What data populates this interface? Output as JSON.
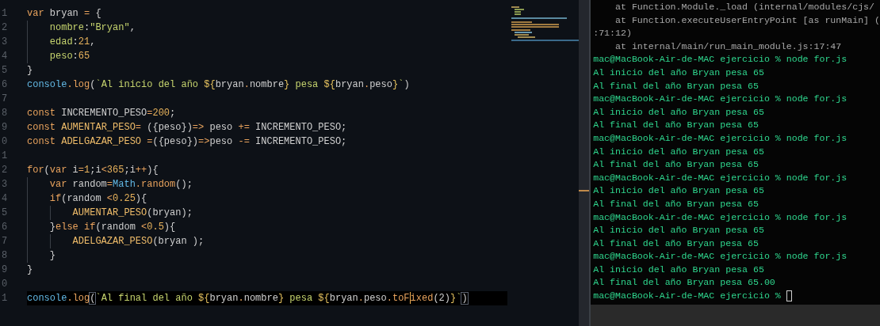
{
  "editor": {
    "lines": [
      {
        "number": "1",
        "current": false,
        "tokens": [
          {
            "t": "var",
            "kind": "kw"
          },
          {
            "t": " bryan ",
            "kind": "id"
          },
          {
            "t": "=",
            "kind": "op"
          },
          {
            "t": " {",
            "kind": "punc"
          }
        ],
        "children": [
          {
            "number": "2",
            "current": false,
            "tokens": [
              {
                "t": "nombre",
                "kind": "prop"
              },
              {
                "t": ":",
                "kind": "punc"
              },
              {
                "t": "\"Bryan\"",
                "kind": "str"
              },
              {
                "t": ",",
                "kind": "punc"
              }
            ]
          },
          {
            "number": "3",
            "current": false,
            "tokens": [
              {
                "t": "edad",
                "kind": "prop"
              },
              {
                "t": ":",
                "kind": "punc"
              },
              {
                "t": "21",
                "kind": "num"
              },
              {
                "t": ",",
                "kind": "punc"
              }
            ]
          },
          {
            "number": "4",
            "current": false,
            "tokens": [
              {
                "t": "peso",
                "kind": "prop"
              },
              {
                "t": ":",
                "kind": "punc"
              },
              {
                "t": "65",
                "kind": "num"
              }
            ]
          }
        ]
      },
      {
        "number": "5",
        "current": false,
        "tokens": [
          {
            "t": "}",
            "kind": "punc"
          }
        ]
      },
      {
        "number": "6",
        "current": false,
        "tokens": [
          {
            "t": "console",
            "kind": "obj"
          },
          {
            "t": ".",
            "kind": "op"
          },
          {
            "t": "log",
            "kind": "fn"
          },
          {
            "t": "(",
            "kind": "punc"
          },
          {
            "t": "`Al inicio del año ",
            "kind": "tpl"
          },
          {
            "t": "${",
            "kind": "interp"
          },
          {
            "t": "bryan",
            "kind": "id"
          },
          {
            "t": ".",
            "kind": "op"
          },
          {
            "t": "nombre",
            "kind": "id"
          },
          {
            "t": "}",
            "kind": "interp"
          },
          {
            "t": " pesa ",
            "kind": "tpl"
          },
          {
            "t": "${",
            "kind": "interp"
          },
          {
            "t": "bryan",
            "kind": "id"
          },
          {
            "t": ".",
            "kind": "op"
          },
          {
            "t": "peso",
            "kind": "id"
          },
          {
            "t": "}",
            "kind": "interp"
          },
          {
            "t": "`",
            "kind": "tpl"
          },
          {
            "t": ")",
            "kind": "punc"
          }
        ]
      },
      {
        "number": "7",
        "current": false
      },
      {
        "number": "8",
        "current": false,
        "tokens": [
          {
            "t": "const",
            "kind": "kw"
          },
          {
            "t": " INCREMENTO_PESO",
            "kind": "id"
          },
          {
            "t": "=",
            "kind": "op"
          },
          {
            "t": "200",
            "kind": "num"
          },
          {
            "t": ";",
            "kind": "punc"
          }
        ]
      },
      {
        "number": "9",
        "current": false,
        "tokens": [
          {
            "t": "const",
            "kind": "kw"
          },
          {
            "t": " AUMENTAR_PESO",
            "kind": "fname"
          },
          {
            "t": "=",
            "kind": "op"
          },
          {
            "t": " ({peso})",
            "kind": "punc"
          },
          {
            "t": "=>",
            "kind": "op"
          },
          {
            "t": " peso ",
            "kind": "id"
          },
          {
            "t": "+=",
            "kind": "op"
          },
          {
            "t": " INCREMENTO_PESO;",
            "kind": "id"
          }
        ]
      },
      {
        "number": "0",
        "current": false,
        "tokens": [
          {
            "t": "const",
            "kind": "kw"
          },
          {
            "t": " ADELGAZAR_PESO ",
            "kind": "fname"
          },
          {
            "t": "=",
            "kind": "op"
          },
          {
            "t": "({peso})",
            "kind": "punc"
          },
          {
            "t": "=>",
            "kind": "op"
          },
          {
            "t": "peso ",
            "kind": "id"
          },
          {
            "t": "-=",
            "kind": "op"
          },
          {
            "t": " INCREMENTO_PESO;",
            "kind": "id"
          }
        ]
      },
      {
        "number": "1",
        "current": false
      },
      {
        "number": "2",
        "current": false,
        "tokens": [
          {
            "t": "for",
            "kind": "kw"
          },
          {
            "t": "(",
            "kind": "punc"
          },
          {
            "t": "var",
            "kind": "kw"
          },
          {
            "t": " i",
            "kind": "id"
          },
          {
            "t": "=",
            "kind": "op"
          },
          {
            "t": "1",
            "kind": "num"
          },
          {
            "t": ";",
            "kind": "punc"
          },
          {
            "t": "i",
            "kind": "id"
          },
          {
            "t": "<",
            "kind": "op"
          },
          {
            "t": "365",
            "kind": "num"
          },
          {
            "t": ";",
            "kind": "punc"
          },
          {
            "t": "i",
            "kind": "id"
          },
          {
            "t": "++",
            "kind": "op"
          },
          {
            "t": "){",
            "kind": "punc"
          }
        ],
        "children": [
          {
            "number": "3",
            "current": false,
            "tokens": [
              {
                "t": "var",
                "kind": "kw"
              },
              {
                "t": " random",
                "kind": "id"
              },
              {
                "t": "=",
                "kind": "op"
              },
              {
                "t": "Math",
                "kind": "obj"
              },
              {
                "t": ".",
                "kind": "op"
              },
              {
                "t": "random",
                "kind": "fn"
              },
              {
                "t": "();",
                "kind": "punc"
              }
            ]
          },
          {
            "number": "4",
            "current": false,
            "tokens": [
              {
                "t": "if",
                "kind": "kw"
              },
              {
                "t": "(",
                "kind": "punc"
              },
              {
                "t": "random ",
                "kind": "id"
              },
              {
                "t": "<",
                "kind": "op"
              },
              {
                "t": "0.25",
                "kind": "num"
              },
              {
                "t": "){",
                "kind": "punc"
              }
            ],
            "children": [
              {
                "number": "5",
                "current": false,
                "tokens": [
                  {
                    "t": "AUMENTAR_PESO",
                    "kind": "fname"
                  },
                  {
                    "t": "(bryan);",
                    "kind": "punc"
                  }
                ]
              }
            ]
          },
          {
            "number": "6",
            "current": false,
            "tokens": [
              {
                "t": "}",
                "kind": "punc"
              },
              {
                "t": "else if",
                "kind": "kw"
              },
              {
                "t": "(",
                "kind": "punc"
              },
              {
                "t": "random ",
                "kind": "id"
              },
              {
                "t": "<",
                "kind": "op"
              },
              {
                "t": "0.5",
                "kind": "num"
              },
              {
                "t": "){",
                "kind": "punc"
              }
            ],
            "children": [
              {
                "number": "7",
                "current": false,
                "tokens": [
                  {
                    "t": "ADELGAZAR_PESO",
                    "kind": "fname"
                  },
                  {
                    "t": "(bryan );",
                    "kind": "punc"
                  }
                ]
              }
            ]
          },
          {
            "number": "8",
            "current": false,
            "tokens": [
              {
                "t": "}",
                "kind": "punc"
              }
            ]
          }
        ]
      },
      {
        "number": "9",
        "current": false,
        "tokens": [
          {
            "t": "}",
            "kind": "punc"
          }
        ]
      },
      {
        "number": "0",
        "current": false
      },
      {
        "number": "1",
        "current": true,
        "tokens": [
          {
            "t": "console",
            "kind": "obj"
          },
          {
            "t": ".",
            "kind": "op"
          },
          {
            "t": "log",
            "kind": "fn"
          },
          {
            "t": "(",
            "kind": "punc",
            "match": true
          },
          {
            "t": "`Al final del año ",
            "kind": "tpl"
          },
          {
            "t": "${",
            "kind": "interp"
          },
          {
            "t": "bryan",
            "kind": "id"
          },
          {
            "t": ".",
            "kind": "op"
          },
          {
            "t": "nombre",
            "kind": "id"
          },
          {
            "t": "}",
            "kind": "interp"
          },
          {
            "t": " pesa ",
            "kind": "tpl"
          },
          {
            "t": "${",
            "kind": "interp"
          },
          {
            "t": "bryan",
            "kind": "id"
          },
          {
            "t": ".",
            "kind": "op"
          },
          {
            "t": "peso",
            "kind": "id"
          },
          {
            "t": ".",
            "kind": "op"
          },
          {
            "t": "toF",
            "kind": "fn"
          },
          {
            "kind": "caret"
          },
          {
            "t": "ixed",
            "kind": "fn"
          },
          {
            "t": "(2)",
            "kind": "punc"
          },
          {
            "t": "}",
            "kind": "interp"
          },
          {
            "t": "`",
            "kind": "tpl"
          },
          {
            "t": ")",
            "kind": "punc",
            "match": true
          }
        ]
      }
    ]
  },
  "terminal": {
    "cursor": true,
    "lines": [
      {
        "kind": "trace",
        "text": "    at Function.Module._load (internal/modules/cjs/"
      },
      {
        "kind": "trace",
        "text": "    at Function.executeUserEntryPoint [as runMain] ("
      },
      {
        "kind": "trace",
        "text": ":71:12)"
      },
      {
        "kind": "trace",
        "text": "    at internal/main/run_main_module.js:17:47"
      },
      {
        "kind": "output",
        "text": "mac@MacBook-Air-de-MAC ejercicio % node for.js"
      },
      {
        "kind": "output",
        "text": "Al inicio del año Bryan pesa 65"
      },
      {
        "kind": "output",
        "text": "Al final del año Bryan pesa 65"
      },
      {
        "kind": "output",
        "text": "mac@MacBook-Air-de-MAC ejercicio % node for.js"
      },
      {
        "kind": "output",
        "text": "Al inicio del año Bryan pesa 65"
      },
      {
        "kind": "output",
        "text": "Al final del año Bryan pesa 65"
      },
      {
        "kind": "output",
        "text": "mac@MacBook-Air-de-MAC ejercicio % node for.js"
      },
      {
        "kind": "output",
        "text": "Al inicio del año Bryan pesa 65"
      },
      {
        "kind": "output",
        "text": "Al final del año Bryan pesa 65"
      },
      {
        "kind": "output",
        "text": "mac@MacBook-Air-de-MAC ejercicio % node for.js"
      },
      {
        "kind": "output",
        "text": "Al inicio del año Bryan pesa 65"
      },
      {
        "kind": "output",
        "text": "Al final del año Bryan pesa 65"
      },
      {
        "kind": "output",
        "text": "mac@MacBook-Air-de-MAC ejercicio % node for.js"
      },
      {
        "kind": "output",
        "text": "Al inicio del año Bryan pesa 65"
      },
      {
        "kind": "output",
        "text": "Al final del año Bryan pesa 65"
      },
      {
        "kind": "output",
        "text": "mac@MacBook-Air-de-MAC ejercicio % node for.js"
      },
      {
        "kind": "output",
        "text": "Al inicio del año Bryan pesa 65"
      },
      {
        "kind": "output",
        "text": "Al final del año Bryan pesa 65.00"
      },
      {
        "kind": "output",
        "text": "mac@MacBook-Air-de-MAC ejercicio %"
      }
    ]
  }
}
